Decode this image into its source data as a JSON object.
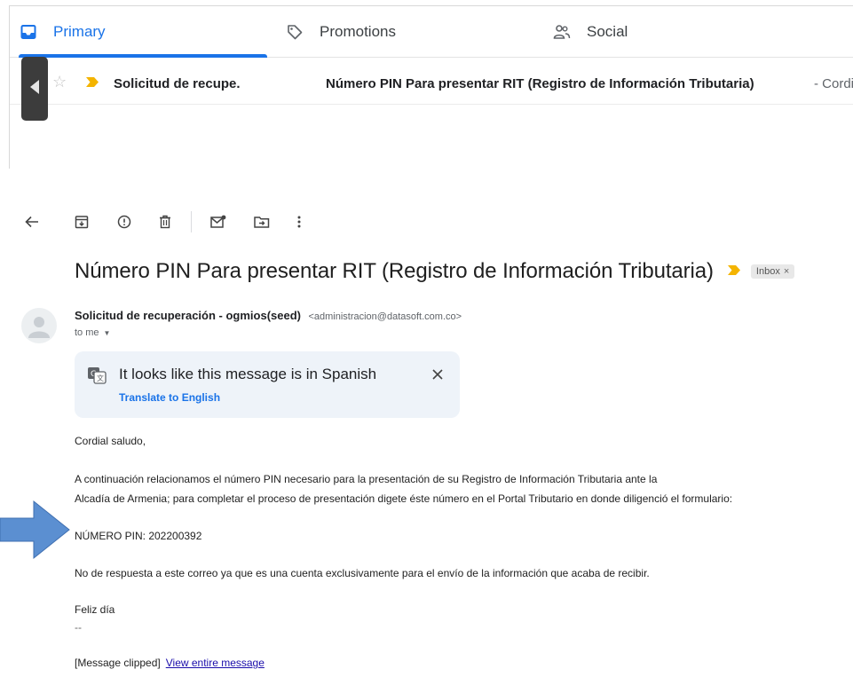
{
  "inbox": {
    "tabs": [
      {
        "label": "Primary",
        "icon": "inbox-icon",
        "active": true
      },
      {
        "label": "Promotions",
        "icon": "tag-icon",
        "active": false
      },
      {
        "label": "Social",
        "icon": "people-icon",
        "active": false
      }
    ],
    "email_row": {
      "sender": "Solicitud de recupe.",
      "subject": "Número PIN Para presentar RIT (Registro de Información Tributaria)",
      "snippet": " - Cordial"
    }
  },
  "message": {
    "subject": "Número PIN Para presentar RIT (Registro de Información Tributaria)",
    "label": "Inbox",
    "label_close": "×",
    "sender_name": "Solicitud de recuperación - ogmios(seed)",
    "sender_email": "<administracion@datasoft.com.co>",
    "recipient": "to me",
    "translate": {
      "message": "It looks like this message is in Spanish",
      "link": "Translate to English"
    },
    "body": {
      "greeting": "Cordial saludo,",
      "para1_line1": "A continuación relacionamos el número PIN necesario para la presentación de su Registro de Información Tributaria ante la",
      "para1_line2": "Alcadía de Armenia; para completar el proceso de presentación digete éste número en el Portal Tributario en donde diligenció el formulario:",
      "pin_line": "NÚMERO PIN: 202200392",
      "note": "No de respuesta a este correo ya que es una cuenta exclusivamente para el envío de la información que acaba de recibir.",
      "closing": "Feliz día",
      "signature_sep": "--",
      "clipped_label": "[Message clipped]",
      "view_entire": "View entire message"
    }
  },
  "colors": {
    "accent": "#1a73e8",
    "important_marker": "#f4b400",
    "arrow": "#5b8fd1"
  }
}
